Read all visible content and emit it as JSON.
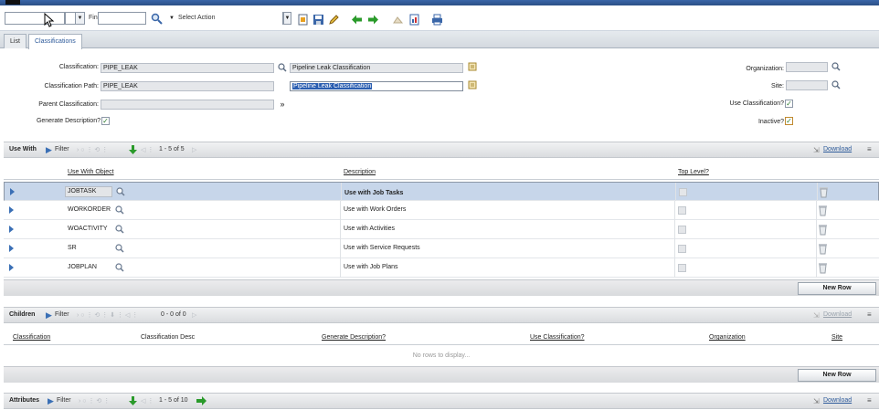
{
  "toolbar": {
    "find_label": "Find:",
    "find_value": "",
    "action_select": "Select Action"
  },
  "tabs": [
    {
      "label": "List",
      "active": false
    },
    {
      "label": "Classifications",
      "active": true
    }
  ],
  "form": {
    "classification_label": "Classification:",
    "classification_value": "PIPE_LEAK",
    "classification_desc": "Pipeline Leak Classification",
    "path_label": "Classification Path:",
    "path_value": "PIPE_LEAK",
    "path_desc": "Pipeline Leak Classification",
    "parent_label": "Parent Classification:",
    "parent_value": "",
    "generate_label": "Generate Description?",
    "generate_checked": true,
    "organization_label": "Organization:",
    "organization_value": "",
    "site_label": "Site:",
    "site_value": "",
    "use_class_label": "Use Classification?",
    "use_class_checked": true,
    "inactive_label": "Inactive?",
    "inactive_checked": true
  },
  "use_with": {
    "title": "Use With",
    "filter_label": "Filter",
    "count": "1 - 5 of 5",
    "download": "Download",
    "columns": [
      "Use With Object",
      "Description",
      "Top Level?"
    ],
    "rows": [
      {
        "object": "JOBTASK",
        "description": "Use with Job Tasks",
        "selected": true
      },
      {
        "object": "WORKORDER",
        "description": "Use with Work Orders",
        "selected": false
      },
      {
        "object": "WOACTIVITY",
        "description": "Use with Activities",
        "selected": false
      },
      {
        "object": "SR",
        "description": "Use with Service Requests",
        "selected": false
      },
      {
        "object": "JOBPLAN",
        "description": "Use with Job Plans",
        "selected": false
      }
    ],
    "new_row": "New Row"
  },
  "children": {
    "title": "Children",
    "filter_label": "Filter",
    "count": "0 - 0 of 0",
    "download": "Download",
    "columns": [
      "Classification",
      "Classification Desc",
      "Generate Description?",
      "Use Classification?",
      "Organization",
      "Site"
    ],
    "empty": "No rows to display",
    "new_row": "New Row"
  },
  "attributes": {
    "title": "Attributes",
    "filter_label": "Filter",
    "count": "1 - 5 of 10",
    "download": "Download"
  },
  "colors": {
    "accent": "#2d5a9a",
    "selected_row": "#c7d6ea",
    "arrow_green": "#2a9a2a"
  }
}
